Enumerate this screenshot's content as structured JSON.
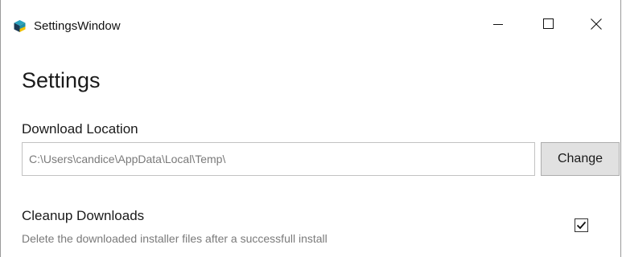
{
  "window": {
    "title": "SettingsWindow",
    "app_icon": "cube-icon",
    "caption_buttons": {
      "minimize": "minimize-icon",
      "maximize": "maximize-icon",
      "close": "close-icon"
    }
  },
  "page": {
    "title": "Settings"
  },
  "download_location": {
    "label": "Download Location",
    "value": "C:\\Users\\candice\\AppData\\Local\\Temp\\",
    "button_label": "Change"
  },
  "cleanup": {
    "label": "Cleanup Downloads",
    "description": "Delete the downloaded installer files after a successfull install",
    "checked": true
  },
  "colors": {
    "icon_teal": "#1f8fa8",
    "icon_dark": "#1b3a55",
    "icon_yellow": "#f2c200",
    "button_bg": "#e1e1e1",
    "muted_text": "#7a7a7a"
  }
}
